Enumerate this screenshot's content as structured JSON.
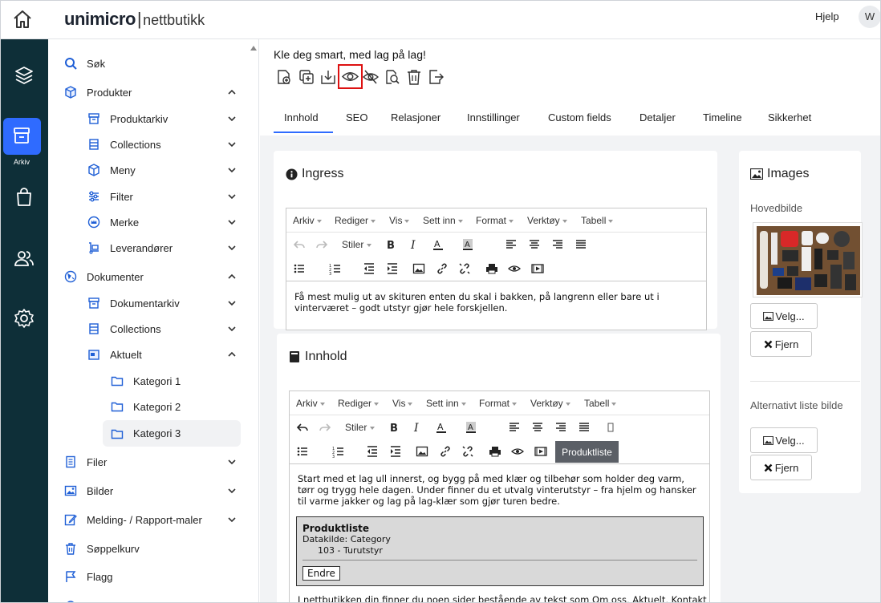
{
  "topbar": {
    "brand": "unimicro",
    "brand_sub": "nettbutikk",
    "brand_sep": "|",
    "help": "Hjelp",
    "avatar": "W"
  },
  "rail": {
    "active_label": "Arkiv"
  },
  "sidebar": {
    "search": "Søk",
    "produkter": "Produkter",
    "produktarkiv": "Produktarkiv",
    "collections1": "Collections",
    "meny": "Meny",
    "filter": "Filter",
    "merke": "Merke",
    "leverandorer": "Leverandører",
    "dokumenter": "Dokumenter",
    "dokumentarkiv": "Dokumentarkiv",
    "collections2": "Collections",
    "aktuelt": "Aktuelt",
    "kat1": "Kategori 1",
    "kat2": "Kategori 2",
    "kat3": "Kategori 3",
    "filer": "Filer",
    "bilder": "Bilder",
    "melding": "Melding- / Rapport-maler",
    "soppel": "Søppelkurv",
    "flagg": "Flagg"
  },
  "page": {
    "title": "Kle deg smart, med lag på lag!"
  },
  "tabs": [
    "Innhold",
    "SEO",
    "Relasjoner",
    "Innstillinger",
    "Custom fields",
    "Detaljer",
    "Timeline",
    "Sikkerhet"
  ],
  "editor_menu": [
    "Arkiv",
    "Rediger",
    "Vis",
    "Sett inn",
    "Format",
    "Verktøy",
    "Tabell"
  ],
  "editor_styles": "Stiler",
  "ingress": {
    "title": "Ingress",
    "text": "Få mest mulig ut av skituren enten du skal i bakken, på langrenn eller bare ut i vinterværet – godt utstyr gjør hele forskjellen."
  },
  "innhold": {
    "title": "Innhold",
    "product_button": "Produktliste",
    "text": "Start med et lag ull innerst, og bygg på med klær og tilbehør som holder deg varm, tørr og trygg hele dagen. Under finner du et utvalg vinterutstyr – fra hjelm og hansker til varme jakker og lag på lag-klær som gjør turen bedre.",
    "pl_title": "Produktliste",
    "pl_source": "Datakilde: Category",
    "pl_item": "103 - Turutstyr",
    "pl_button": "Endre",
    "tail": "I nettbutikken din finner du noen sider bestående av tekst som Om oss, Aktuelt, Kontakt"
  },
  "images": {
    "title": "Images",
    "main_label": "Hovedbilde",
    "alt_label": "Alternativt liste bilde",
    "select": "Velg...",
    "remove": "Fjern"
  }
}
